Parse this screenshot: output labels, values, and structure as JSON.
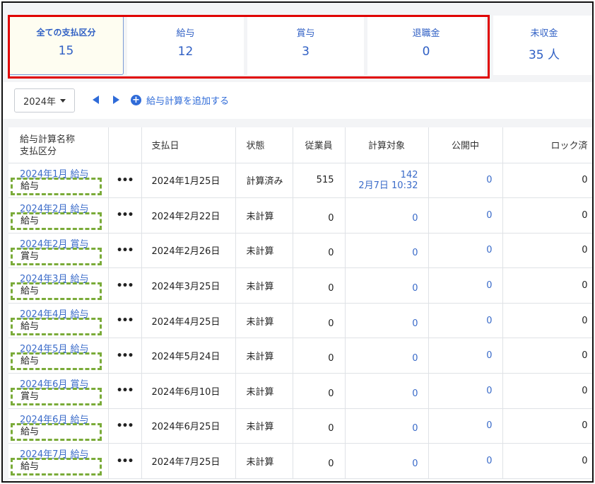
{
  "summary_cards": [
    {
      "label": "全ての支払区分",
      "value": "15",
      "active": true
    },
    {
      "label": "給与",
      "value": "12",
      "active": false
    },
    {
      "label": "賞与",
      "value": "3",
      "active": false
    },
    {
      "label": "退職金",
      "value": "0",
      "active": false
    },
    {
      "label": "未収金",
      "value": "35 人",
      "active": false
    }
  ],
  "toolbar": {
    "year_select": "2024年",
    "add_label": "給与計算を追加する"
  },
  "table": {
    "headers": {
      "name_line1": "給与計算名称",
      "name_line2": "支払区分",
      "payment_date": "支払日",
      "status": "状態",
      "employees": "従業員",
      "calc_target": "計算対象",
      "published": "公開中",
      "locked": "ロック済"
    },
    "menu_glyph": "•••",
    "rows": [
      {
        "name": "2024年1月 給与",
        "type": "給与",
        "date": "2024年1月25日",
        "status": "計算済み",
        "employees": "515",
        "calc_count": "142",
        "calc_time": "2月7日 10:32",
        "published": "0",
        "locked": "0"
      },
      {
        "name": "2024年2月 給与",
        "type": "給与",
        "date": "2024年2月22日",
        "status": "未計算",
        "employees": "0",
        "calc_count": "0",
        "calc_time": "",
        "published": "0",
        "locked": "0"
      },
      {
        "name": "2024年2月 賞与",
        "type": "賞与",
        "date": "2024年2月26日",
        "status": "未計算",
        "employees": "0",
        "calc_count": "0",
        "calc_time": "",
        "published": "0",
        "locked": "0"
      },
      {
        "name": "2024年3月 給与",
        "type": "給与",
        "date": "2024年3月25日",
        "status": "未計算",
        "employees": "0",
        "calc_count": "0",
        "calc_time": "",
        "published": "0",
        "locked": "0"
      },
      {
        "name": "2024年4月 給与",
        "type": "給与",
        "date": "2024年4月25日",
        "status": "未計算",
        "employees": "0",
        "calc_count": "0",
        "calc_time": "",
        "published": "0",
        "locked": "0"
      },
      {
        "name": "2024年5月 給与",
        "type": "給与",
        "date": "2024年5月24日",
        "status": "未計算",
        "employees": "0",
        "calc_count": "0",
        "calc_time": "",
        "published": "0",
        "locked": "0"
      },
      {
        "name": "2024年6月 賞与",
        "type": "賞与",
        "date": "2024年6月10日",
        "status": "未計算",
        "employees": "0",
        "calc_count": "0",
        "calc_time": "",
        "published": "0",
        "locked": "0"
      },
      {
        "name": "2024年6月 給与",
        "type": "給与",
        "date": "2024年6月25日",
        "status": "未計算",
        "employees": "0",
        "calc_count": "0",
        "calc_time": "",
        "published": "0",
        "locked": "0"
      },
      {
        "name": "2024年7月 給与",
        "type": "給与",
        "date": "2024年7月25日",
        "status": "未計算",
        "employees": "0",
        "calc_count": "0",
        "calc_time": "",
        "published": "0",
        "locked": "0"
      }
    ]
  },
  "colors": {
    "link_blue": "#3a6bc9",
    "highlight_red": "#e00000",
    "tag_dashed_green": "#7aab39"
  }
}
